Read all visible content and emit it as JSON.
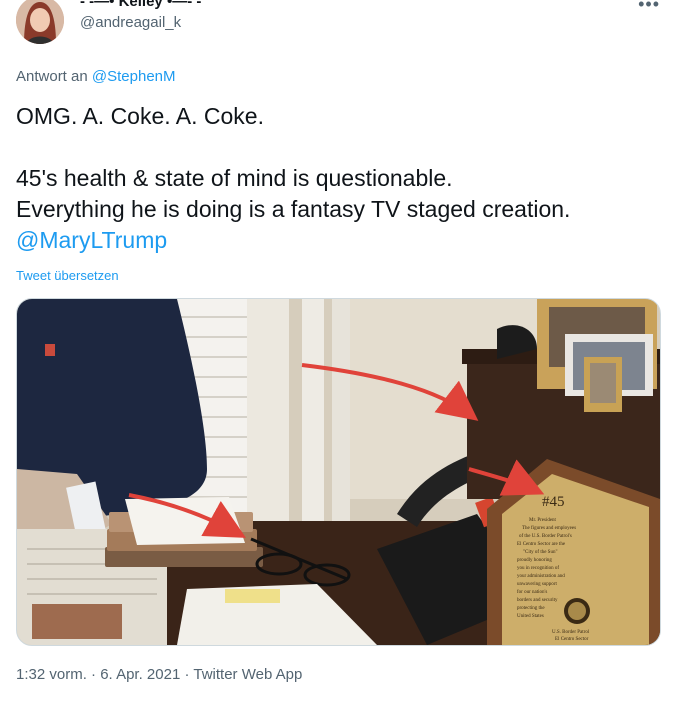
{
  "author": {
    "display_name": "- -—• Kelley •—- -",
    "handle": "@andreagail_k"
  },
  "more_icon": "more-horizontal-icon",
  "reply": {
    "prefix": "Antwort an",
    "to": "@StephenM"
  },
  "tweet": {
    "line1": "OMG. A. Coke. A. Coke.",
    "line2": "45's health & state of mind is questionable.",
    "line3": "Everything he is doing is a fantasy TV staged creation.",
    "mention": "@MaryLTrump"
  },
  "translate_label": "Tweet übersetzen",
  "media": {
    "plaque_number": "#45",
    "plaque_text": [
      "Mr. President",
      "The figures and employees",
      "of the U.S. Border Patrol's",
      "El Centro Sector are the",
      "\"City of the Sun\"",
      "proudly honoring",
      "you in recognition of",
      "your administration and",
      "unwavering support",
      "for our nation's",
      "borders and security",
      "protecting the",
      "United States"
    ],
    "plaque_footer": [
      "U.S. Border Patrol",
      "El Centro Sector"
    ]
  },
  "timestamp": {
    "time": "1:32 vorm.",
    "sep1": "·",
    "date": "6. Apr. 2021",
    "sep2": "·",
    "source": "Twitter Web App"
  },
  "colors": {
    "link": "#1d9bf0",
    "muted": "#536471",
    "arrow": "#e0433a"
  }
}
